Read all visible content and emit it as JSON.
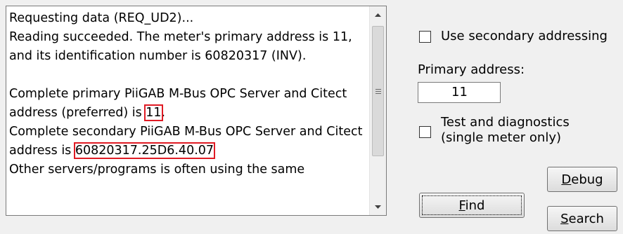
{
  "log": {
    "lines": [
      "Requesting data (REQ_UD2)...",
      "Reading succeeded. The meter's primary address is 11, and its identification number is 60820317 (INV).",
      "Complete primary PiiGAB M-Bus OPC Server and Citect address (preferred) is ",
      "11",
      ".",
      "Complete secondary PiiGAB M-Bus OPC Server and Citect address is ",
      "60820317.25D6.40.07",
      "Other servers/programs is often using the same"
    ]
  },
  "options": {
    "secondary_addressing_label": "Use secondary addressing",
    "secondary_addressing_checked": false,
    "primary_address_label": "Primary address:",
    "primary_address_value": "11",
    "test_diag_label_line1": "Test and diagnostics",
    "test_diag_label_line2": "(single meter only)",
    "test_diag_checked": false
  },
  "buttons": {
    "debug_mnemonic": "D",
    "debug_rest": "ebug",
    "find_mnemonic": "F",
    "find_rest": "ind",
    "search_mnemonic": "S",
    "search_rest": "earch"
  },
  "colors": {
    "highlight_box": "#e01b24"
  }
}
